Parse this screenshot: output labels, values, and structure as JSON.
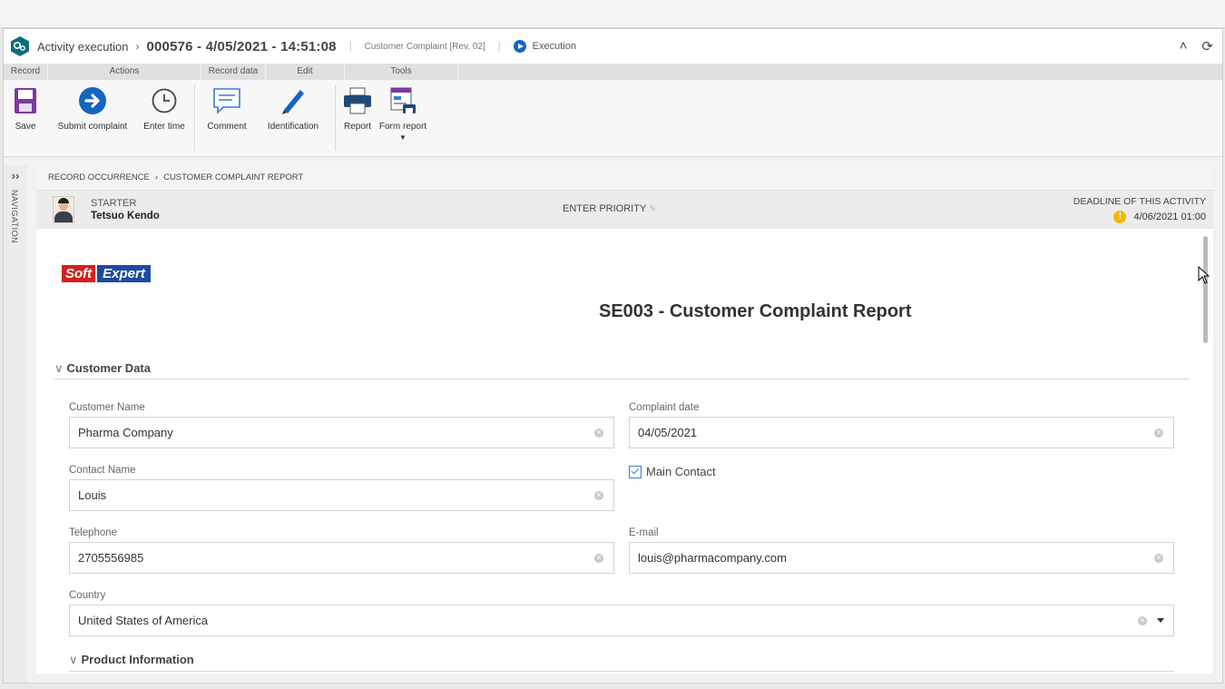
{
  "header": {
    "crumb": "Activity execution",
    "record": "000576 - 4/05/2021 - 14:51:08",
    "form": "Customer Complaint [Rev. 02]",
    "status": "Execution"
  },
  "ribbon": {
    "groups": [
      "Record",
      "Actions",
      "Record data",
      "Edit",
      "Tools"
    ],
    "buttons": {
      "save": "Save",
      "submit": "Submit complaint",
      "enter_time": "Enter time",
      "comment": "Comment",
      "identification": "Identification",
      "report": "Report",
      "form_report": "Form report"
    }
  },
  "nav": {
    "label": "NAVIGATION"
  },
  "breadcrumb": {
    "first": "RECORD OCCURRENCE",
    "second": "CUSTOMER COMPLAINT REPORT"
  },
  "info": {
    "starter_label": "STARTER",
    "starter_name": "Tetsuo Kendo",
    "priority": "ENTER PRIORITY",
    "deadline_label": "DEADLINE OF THIS ACTIVITY",
    "deadline_value": "4/06/2021 01:00"
  },
  "form": {
    "logo_soft": "Soft",
    "logo_expert": "Expert",
    "title": "SE003 - Customer Complaint Report",
    "sections": {
      "customer": "Customer Data",
      "product": "Product Information"
    },
    "customer_name": {
      "label": "Customer Name",
      "value": "Pharma Company"
    },
    "complaint_date": {
      "label": "Complaint date",
      "value": "04/05/2021"
    },
    "contact_name": {
      "label": "Contact Name",
      "value": "Louis"
    },
    "main_contact": {
      "label": "Main Contact",
      "checked": true
    },
    "telephone": {
      "label": "Telephone",
      "value": "2705556985"
    },
    "email": {
      "label": "E-mail",
      "value": "louis@pharmacompany.com"
    },
    "country": {
      "label": "Country",
      "value": "United States of America"
    }
  }
}
